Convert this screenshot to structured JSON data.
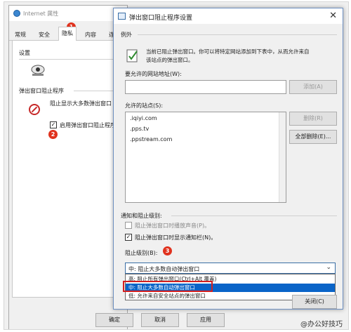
{
  "back_window": {
    "title": "Internet 属性",
    "badge_1": "1",
    "tabs": [
      "常规",
      "安全",
      "隐私",
      "内容",
      "连"
    ],
    "active_tab_index": 2,
    "settings_label": "设置",
    "popup_section_label": "弹出窗口阻止程序",
    "block_popups_text": "阻止显示大多数弹出窗口",
    "enable_blocker_label": "启用弹出窗口阻止程序",
    "enable_blocker_checked": true,
    "badge_2": "2",
    "ok_button": "确定",
    "cancel_button": "取消",
    "apply_button": "应用"
  },
  "dialog": {
    "title": "弹出窗口阻止程序设置",
    "close_label": "✕",
    "exceptions_label": "例外",
    "exceptions_desc_line1": "当前已阻止弹出窗口。你可以将特定网站添加到下表中，从而允许来自",
    "exceptions_desc_line2": "该站点的弹出窗口。",
    "address_label": "要允许的网站地址(W):",
    "address_value": "",
    "add_button": "添加(A)",
    "allowed_sites_label": "允许的站点(S):",
    "allowed_sites": [
      ".iqiyi.com",
      ".pps.tv",
      ".ppstream.com"
    ],
    "remove_button": "删除(R)",
    "remove_all_button": "全部删除(E)...",
    "notify_section_label": "通知和阻止级别:",
    "play_sound_label": "阻止弹出窗口时播放声音(P)。",
    "play_sound_checked": false,
    "show_bar_label": "阻止弹出窗口时显示通知栏(N)。",
    "show_bar_checked": true,
    "block_level_label": "阻止级别(B):",
    "badge_3": "3",
    "block_level_selected": "中: 阻止大多数自动弹出窗口",
    "block_level_options": [
      "高: 阻止所有弹出窗口(Ctrl+Alt 覆盖)",
      "中: 阻止大多数自动弹出窗口",
      "低: 允许来自安全站点的弹出窗口"
    ],
    "block_level_highlight_index": 1,
    "close_button": "关闭(C)"
  },
  "watermark": "@办公好技巧",
  "colors": {
    "badge": "#e0321e",
    "selection": "#0a64c8",
    "highlight_box": "#d32020"
  }
}
